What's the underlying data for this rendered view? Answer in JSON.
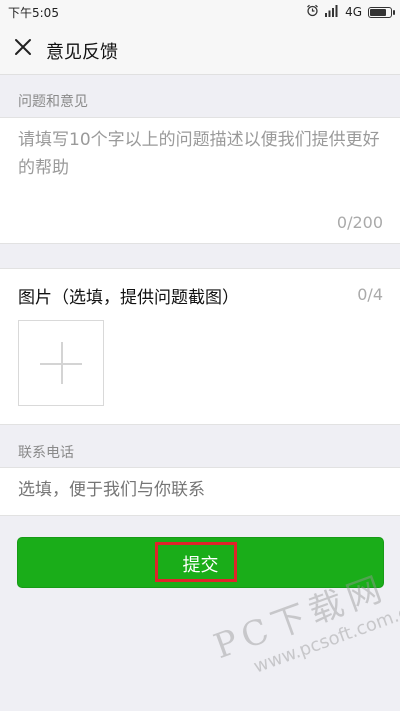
{
  "status_bar": {
    "time": "下午5:05",
    "network": "4G",
    "alarm_icon": "alarm-icon",
    "signal_icon": "signal-icon",
    "battery_icon": "battery-icon"
  },
  "header": {
    "close_icon": "close-icon",
    "title": "意见反馈"
  },
  "issue_section": {
    "label": "问题和意见",
    "placeholder": "请填写10个字以上的问题描述以便我们提供更好的帮助",
    "counter": "0/200"
  },
  "images_section": {
    "title": "图片（选填，提供问题截图）",
    "counter": "0/4",
    "add_icon": "plus-icon"
  },
  "phone_section": {
    "label": "联系电话",
    "placeholder": "选填，便于我们与你联系"
  },
  "submit": {
    "label": "提交",
    "color": "#1aad19",
    "highlight_color": "#e0242a"
  },
  "watermark": {
    "main": "PC下载网",
    "sub": "www.pcsoft.com.cn"
  }
}
